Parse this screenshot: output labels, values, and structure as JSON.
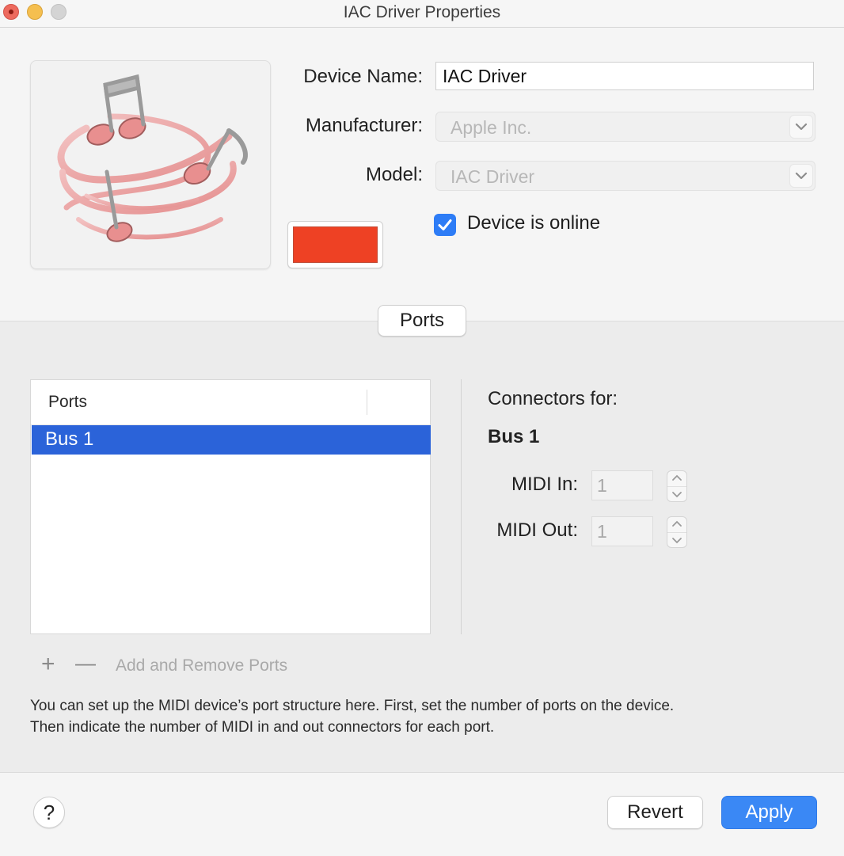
{
  "window": {
    "title": "IAC Driver Properties"
  },
  "device": {
    "name_label": "Device Name:",
    "name_value": "IAC Driver",
    "manufacturer_label": "Manufacturer:",
    "manufacturer_value": "Apple Inc.",
    "model_label": "Model:",
    "model_value": "IAC Driver",
    "online_label": "Device is online",
    "online_checked": true,
    "color": "#ee4124"
  },
  "tabs": {
    "ports_label": "Ports"
  },
  "ports_table": {
    "header": "Ports",
    "rows": [
      {
        "label": "Bus 1",
        "selected": true
      }
    ]
  },
  "connectors": {
    "title": "Connectors for:",
    "bus_name": "Bus 1",
    "midi_in_label": "MIDI In:",
    "midi_in_value": "1",
    "midi_out_label": "MIDI Out:",
    "midi_out_value": "1"
  },
  "ports_actions": {
    "add_symbol": "+",
    "remove_symbol": "—",
    "label": "Add and Remove Ports"
  },
  "description": {
    "line1": "You can set up the MIDI device’s port structure here. First, set the number of ports on the device.",
    "line2": "Then indicate the number of MIDI in and out connectors for each port."
  },
  "footer": {
    "help_symbol": "?",
    "revert_label": "Revert",
    "apply_label": "Apply"
  },
  "colors": {
    "accent": "#3a88f5",
    "selection": "#2b63d9",
    "checkbox": "#2d7cf6"
  }
}
